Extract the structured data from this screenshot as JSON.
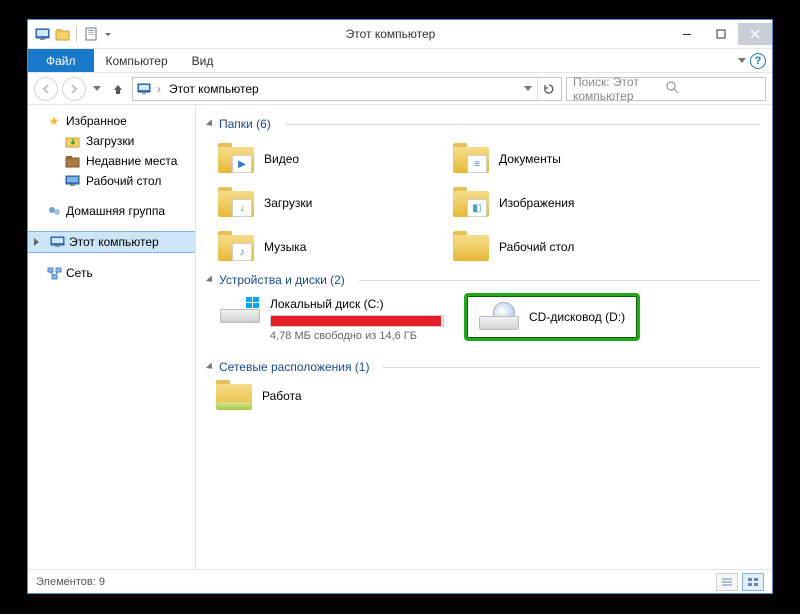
{
  "title": "Этот компьютер",
  "menu": {
    "file": "Файл",
    "computer": "Компьютер",
    "view": "Вид"
  },
  "address": {
    "segment": "Этот компьютер"
  },
  "search": {
    "placeholder": "Поиск: Этот компьютер"
  },
  "sidebar": {
    "favorites": {
      "label": "Избранное",
      "items": [
        "Загрузки",
        "Недавние места",
        "Рабочий стол"
      ]
    },
    "homegroup": "Домашняя группа",
    "thispc": "Этот компьютер",
    "network": "Сеть"
  },
  "sections": {
    "folders": {
      "title": "Папки (6)",
      "items": [
        "Видео",
        "Документы",
        "Загрузки",
        "Изображения",
        "Музыка",
        "Рабочий стол"
      ]
    },
    "devices": {
      "title": "Устройства и диски (2)",
      "local": {
        "name": "Локальный диск (C:)",
        "free": "4,78 МБ свободно из 14,6 ГБ"
      },
      "cd": {
        "name": "CD-дисковод (D:)"
      }
    },
    "network": {
      "title": "Сетевые расположения (1)",
      "item": "Работа"
    }
  },
  "status": {
    "count": "Элементов: 9"
  }
}
